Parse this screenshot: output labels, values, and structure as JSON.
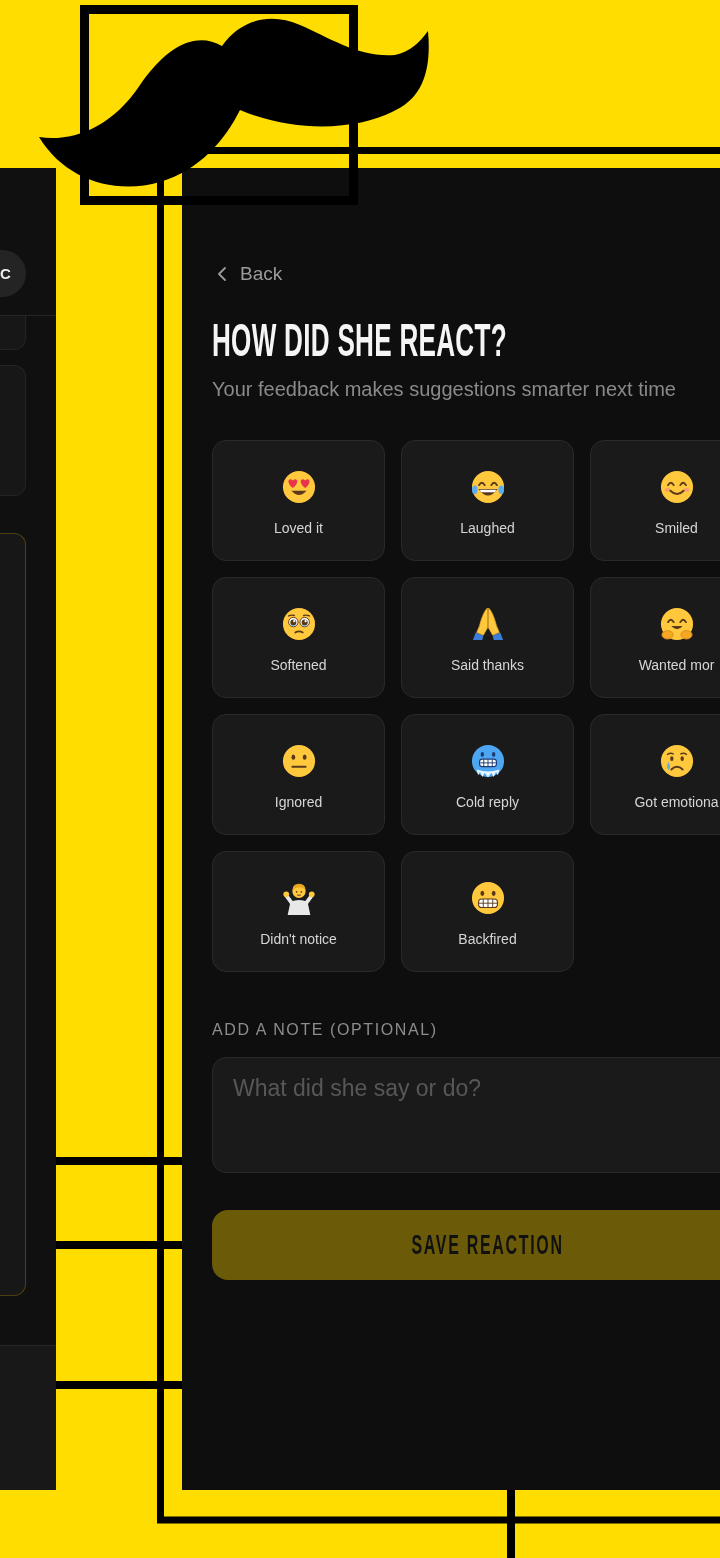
{
  "left_panel": {
    "avatar": {
      "initial": "C"
    },
    "cards": [
      {
        "selected": false
      },
      {
        "selected": false
      },
      {
        "selected": true
      }
    ]
  },
  "back_link": {
    "label": "Back"
  },
  "title": "HOW DID SHE REACT?",
  "subtitle": "Your feedback makes suggestions smarter next time",
  "reactions": [
    {
      "kind": "hearteyes",
      "label": "Loved it",
      "selected": false
    },
    {
      "kind": "laughing",
      "label": "Laughed",
      "selected": false
    },
    {
      "kind": "smiling",
      "label": "Smiled",
      "selected": false
    },
    {
      "kind": "teary",
      "label": "Softened",
      "selected": false
    },
    {
      "kind": "praying",
      "label": "Said thanks",
      "selected": false
    },
    {
      "kind": "hugging",
      "label": "Wanted mor",
      "selected": false
    },
    {
      "kind": "neutral",
      "label": "Ignored",
      "selected": false
    },
    {
      "kind": "freezing",
      "label": "Cold reply",
      "selected": false
    },
    {
      "kind": "crying",
      "label": "Got emotiona",
      "selected": false
    },
    {
      "kind": "shrugging",
      "label": "Didn't notice",
      "selected": false
    },
    {
      "kind": "grimacing",
      "label": "Backfired",
      "selected": false
    }
  ],
  "note": {
    "label": "ADD A NOTE (OPTIONAL)",
    "placeholder": "What did she say or do?"
  },
  "save_button": {
    "label": "SAVE REACTION",
    "disabled": true
  }
}
